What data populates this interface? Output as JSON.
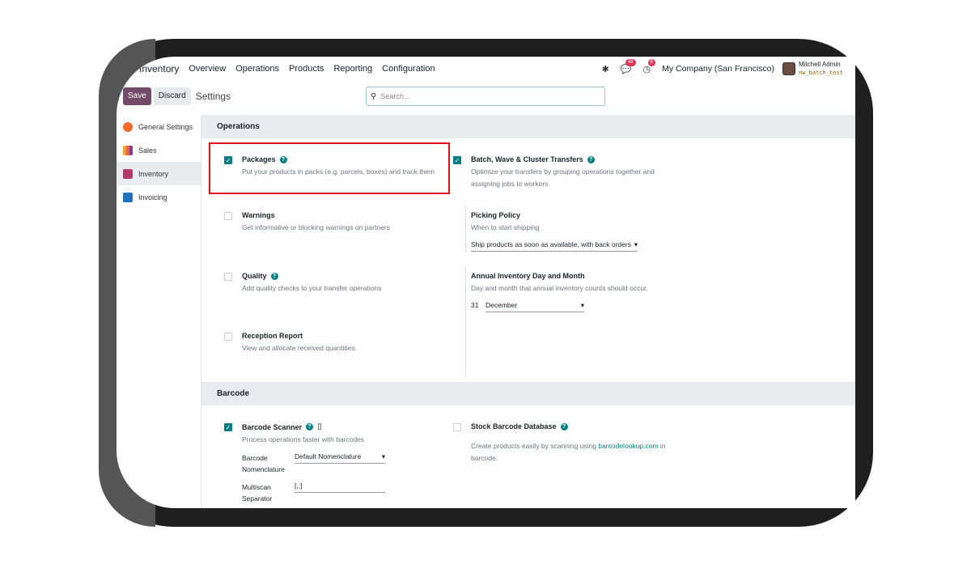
{
  "navbar": {
    "app": "Inventory",
    "menu": [
      "Overview",
      "Operations",
      "Products",
      "Reporting",
      "Configuration"
    ],
    "messages_count": "49",
    "activity_count": "8",
    "company": "My Company (San Francisco)",
    "user_name": "Mitchell Admin",
    "user_db": "nw_batch_test"
  },
  "control": {
    "save_label": "Save",
    "discard_label": "Discard",
    "title": "Settings",
    "search_placeholder": "Search..."
  },
  "sidebar": {
    "items": [
      {
        "label": "General Settings",
        "color": "#f06a2b"
      },
      {
        "label": "Sales",
        "color": "#e8643a"
      },
      {
        "label": "Inventory",
        "color": "#b23b6b"
      },
      {
        "label": "Invoicing",
        "color": "#1e6fbd"
      }
    ]
  },
  "sections": {
    "operations": {
      "heading": "Operations",
      "packages": {
        "title": "Packages",
        "desc": "Put your products in packs (e.g. parcels, boxes) and track them",
        "checked": true
      },
      "batch": {
        "title": "Batch, Wave & Cluster Transfers",
        "desc": "Optimize your transfers by grouping operations together and assigning jobs to workers",
        "checked": true
      },
      "warnings": {
        "title": "Warnings",
        "desc": "Get informative or blocking warnings on partners",
        "checked": false
      },
      "picking": {
        "title": "Picking Policy",
        "desc": "When to start shipping",
        "value": "Ship products as soon as available, with back orders"
      },
      "quality": {
        "title": "Quality",
        "desc": "Add quality checks to your transfer operations",
        "checked": false
      },
      "annual": {
        "title": "Annual Inventory Day and Month",
        "desc": "Day and month that annual inventory counts should occur.",
        "day": "31",
        "month": "December"
      },
      "reception": {
        "title": "Reception Report",
        "desc": "View and allocate received quantities.",
        "checked": false
      }
    },
    "barcode": {
      "heading": "Barcode",
      "scanner": {
        "title": "Barcode Scanner",
        "desc": "Process operations faster with barcodes",
        "checked": true,
        "nomenclature_label": "Barcode Nomenclature",
        "nomenclature_value": "Default Nomenclature",
        "multiscan_label": "Multiscan Separator",
        "multiscan_value": "[,;]"
      },
      "stock_db": {
        "title": "Stock Barcode Database",
        "desc_pre": "Create products easily by scanning using ",
        "desc_link": "barcodelookup.com",
        "desc_post": " in barcode.",
        "checked": false
      }
    }
  }
}
